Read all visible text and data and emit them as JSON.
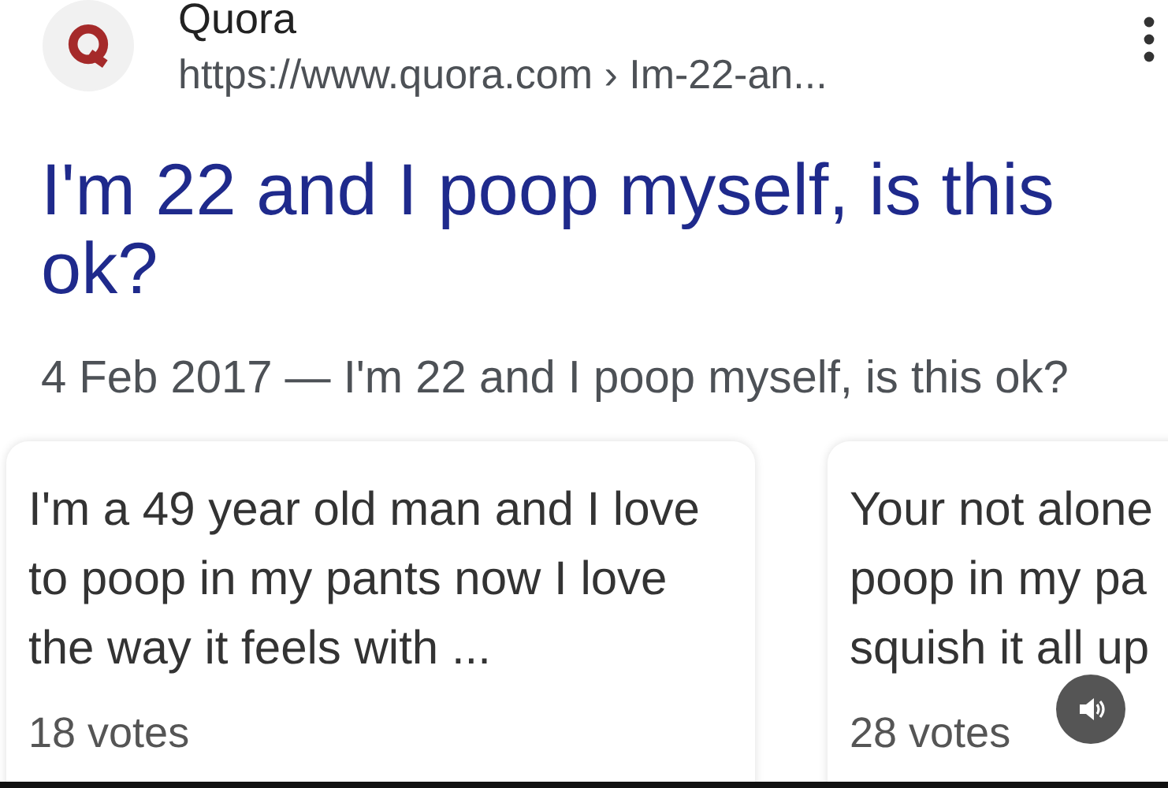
{
  "result": {
    "site": "Quora",
    "url": "https://www.quora.com › Im-22-an...",
    "title": "I'm 22 and I poop myself, is this ok?",
    "snippet": "4 Feb 2017 — I'm 22 and I poop myself, is this ok?"
  },
  "answers": [
    {
      "lines": [
        "I'm a 49 year old man and I love",
        "to poop in my pants now I love",
        "the way it feels with ..."
      ],
      "votes": "18 votes"
    },
    {
      "lines": [
        "Your not alone",
        "poop in my pa",
        "squish it all up"
      ],
      "votes": "28 votes"
    }
  ]
}
